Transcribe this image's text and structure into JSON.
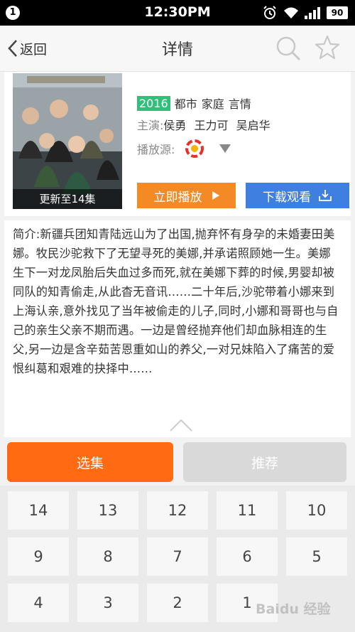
{
  "status_bar": {
    "notification_count": "1",
    "time": "12:30PM",
    "battery": "90",
    "icons": [
      "alarm-icon",
      "wifi-icon",
      "signal-icon",
      "battery-icon"
    ]
  },
  "nav": {
    "back_label": "返回",
    "title": "详情",
    "icons": [
      "search-icon",
      "star-icon"
    ]
  },
  "show": {
    "poster_label": "更新至14集",
    "year": "2016",
    "genres": [
      "都市",
      "家庭",
      "言情"
    ],
    "cast_label": "主演:",
    "cast": [
      "侯勇",
      "王力可",
      "吴启华"
    ],
    "source_label": "播放源:",
    "play_label": "立即播放",
    "download_label": "下载观看"
  },
  "synopsis": "简介:新疆兵团知青陆远山为了出国,抛弃怀有身孕的未婚妻田美娜。牧民沙驼救下了无望寻死的美娜,并承诺照顾她一生。美娜生下一对龙凤胎后失血过多而死,就在美娜下葬的时候,男婴却被同队的知青偷走,从此杳无音讯……二十年后,沙驼带着小娜来到上海认亲,意外找见了当年被偷走的儿子,同时,小娜和哥哥也与自己的亲生父亲不期而遇。一边是曾经抛弃他们却血脉相连的生父,另一边是含辛茹苦恩重如山的养父,一对兄妹陷入了痛苦的爱恨纠葛和艰难的抉择中……",
  "tabs": {
    "episodes": "选集",
    "recommend": "推荐"
  },
  "episodes": [
    "14",
    "13",
    "12",
    "11",
    "10",
    "9",
    "8",
    "7",
    "6",
    "5",
    "4",
    "3",
    "2",
    "1"
  ],
  "watermark": "Baidu 经验",
  "colors": {
    "orange": "#ff6a13",
    "play_orange": "#f38a26",
    "blue": "#3f7fe0",
    "green": "#2fc17a"
  }
}
